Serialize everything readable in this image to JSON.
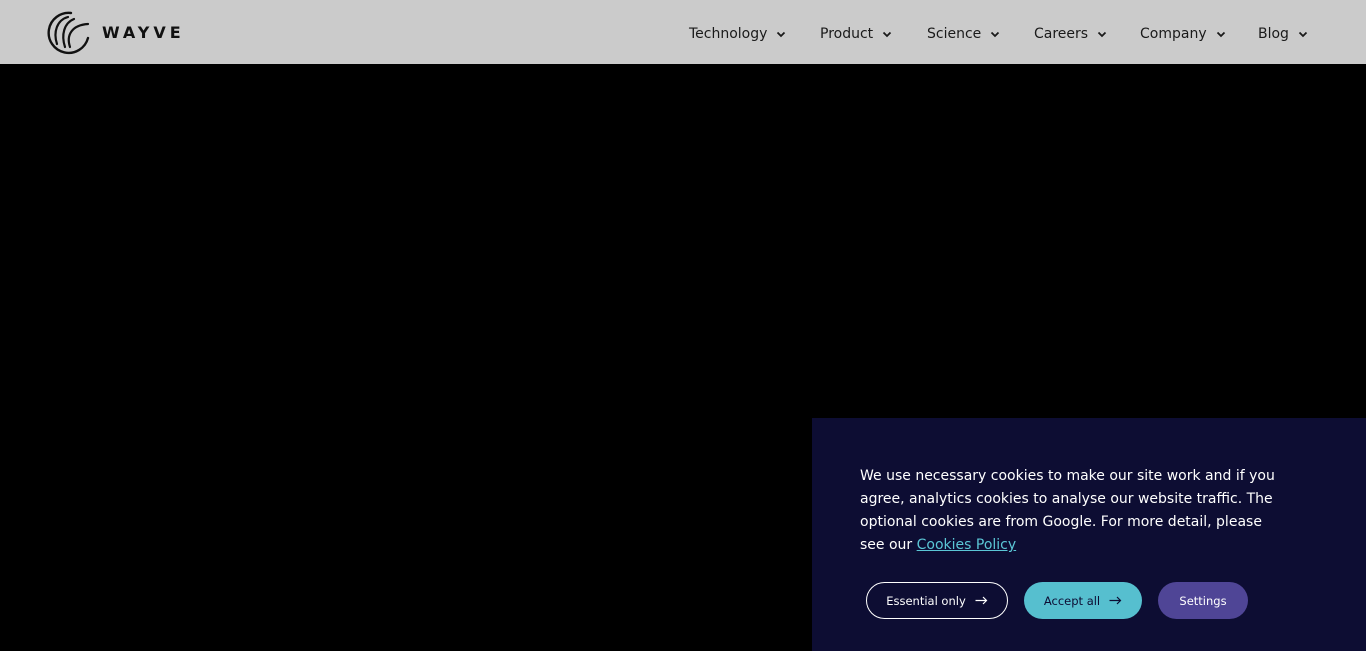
{
  "brand": {
    "name": "WAYVE",
    "logo_icon": "wayve-wave-logo"
  },
  "nav": {
    "items": [
      {
        "label": "Technology",
        "icon": "chevron-down-icon"
      },
      {
        "label": "Product",
        "icon": "chevron-down-icon"
      },
      {
        "label": "Science",
        "icon": "chevron-down-icon"
      },
      {
        "label": "Careers",
        "icon": "chevron-down-icon"
      },
      {
        "label": "Company",
        "icon": "chevron-down-icon"
      },
      {
        "label": "Blog",
        "icon": "chevron-down-icon"
      }
    ]
  },
  "cookie_banner": {
    "text": "We use necessary cookies to make our site work and if you agree, analytics cookies to analyse our website traffic. The optional cookies are from Google. For more detail, please see our",
    "link_label": "Cookies Policy",
    "buttons": {
      "essential": "Essential only",
      "accept": "Accept all",
      "settings": "Settings"
    }
  },
  "colors": {
    "header_bg": "#cbcbcb",
    "hero_bg": "#000000",
    "banner_bg": "#0d0d33",
    "link": "#5bc6d6",
    "accept_bg": "#56bfcf",
    "settings_bg": "#4f4596"
  }
}
